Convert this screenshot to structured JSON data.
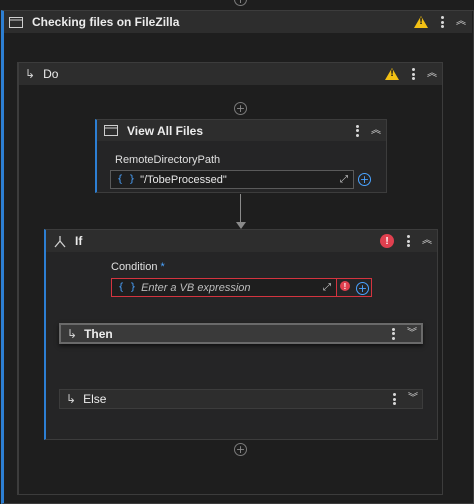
{
  "outer": {
    "title": "Checking files on FileZilla"
  },
  "do_block": {
    "title": "Do"
  },
  "view_all_files": {
    "title": "View All Files",
    "field_label": "RemoteDirectoryPath",
    "field_value": "\"/TobeProcessed\""
  },
  "if_block": {
    "title": "If",
    "condition_label": "Condition",
    "required_marker": "*",
    "condition_placeholder": "Enter a VB expression",
    "then_label": "Then",
    "else_label": "Else"
  },
  "colors": {
    "accent": "#4aa3ff",
    "warning": "#f2c014",
    "error": "#e0404f"
  },
  "icons": [
    "window-icon",
    "warning-icon",
    "kebab-menu-icon",
    "collapse-chevron-icon",
    "expand-chevron-icon",
    "sequence-arrow-icon",
    "if-branch-icon",
    "add-activity-icon",
    "curly-braces-icon",
    "expand-editor-icon",
    "error-icon"
  ]
}
